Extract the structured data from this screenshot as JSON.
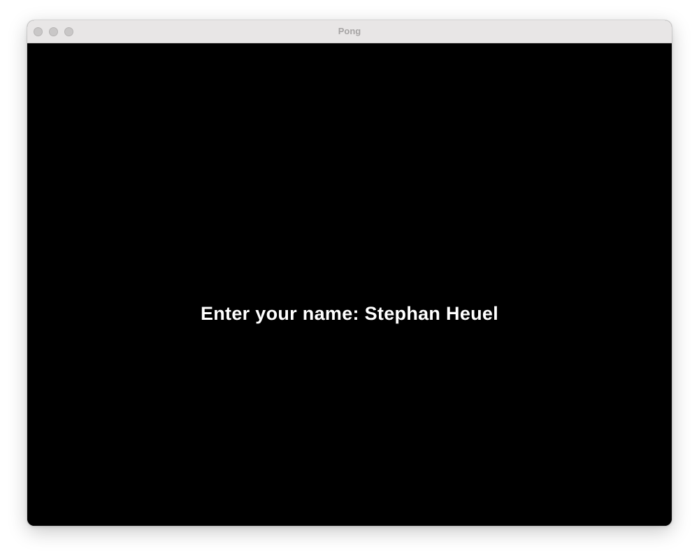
{
  "window": {
    "title": "Pong"
  },
  "titlebar": {
    "buttons": [
      {
        "icon": "close-dot-icon",
        "color": "#c9c7c7"
      },
      {
        "icon": "minimize-dot-icon",
        "color": "#c9c7c7"
      },
      {
        "icon": "zoom-dot-icon",
        "color": "#c9c7c7"
      }
    ]
  },
  "game": {
    "background_color": "#000000",
    "text_color": "#ffffff",
    "prompt_text": "Enter your name: Stephan Heuel"
  }
}
